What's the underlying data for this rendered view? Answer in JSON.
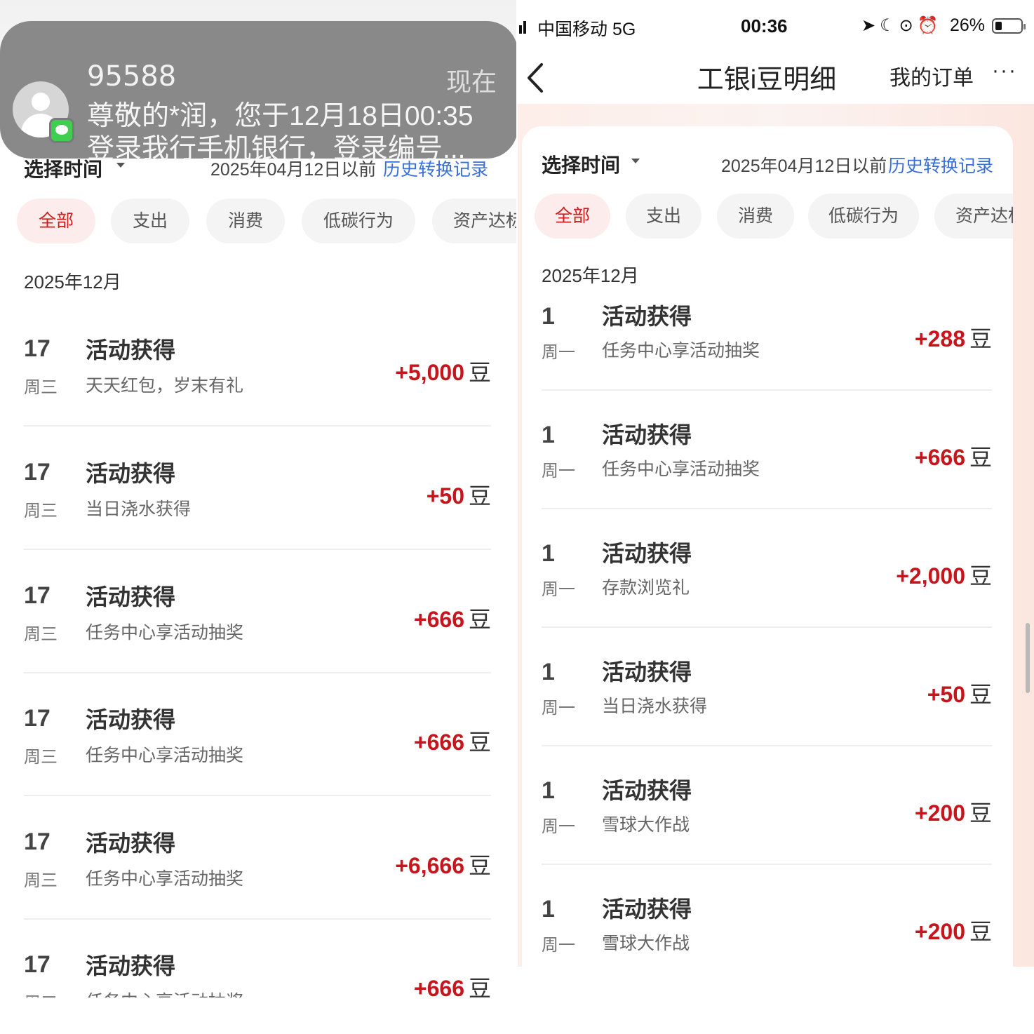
{
  "notification": {
    "sender": "95588",
    "time": "现在",
    "line1": "尊敬的*润，您于12月18日00:35",
    "line2": "登录我行手机银行，登录编号..."
  },
  "status_bar": {
    "carrier": "中国移动  5G",
    "time": "00:36",
    "battery": "26%",
    "battery_level": 0.26
  },
  "nav": {
    "title": "工银i豆明细",
    "orders": "我的订单",
    "more": "···"
  },
  "filter": {
    "select_time": "选择时间",
    "before_text": "2025年04月12日以前",
    "history_link": "历史转换记录"
  },
  "tabs": [
    "全部",
    "支出",
    "消费",
    "低碳行为",
    "资产达标"
  ],
  "unit": "豆",
  "left": {
    "month": "2025年12月",
    "items": [
      {
        "day": "17",
        "weekday": "周三",
        "title": "活动获得",
        "desc": "天天红包，岁末有礼",
        "amount": "+5,000"
      },
      {
        "day": "17",
        "weekday": "周三",
        "title": "活动获得",
        "desc": "当日浇水获得",
        "amount": "+50"
      },
      {
        "day": "17",
        "weekday": "周三",
        "title": "活动获得",
        "desc": "任务中心享活动抽奖",
        "amount": "+666"
      },
      {
        "day": "17",
        "weekday": "周三",
        "title": "活动获得",
        "desc": "任务中心享活动抽奖",
        "amount": "+666"
      },
      {
        "day": "17",
        "weekday": "周三",
        "title": "活动获得",
        "desc": "任务中心享活动抽奖",
        "amount": "+6,666"
      },
      {
        "day": "17",
        "weekday": "周三",
        "title": "活动获得",
        "desc": "任务中心享活动抽奖",
        "amount": "+666"
      }
    ]
  },
  "right": {
    "month": "2025年12月",
    "items": [
      {
        "day": "1",
        "weekday": "周一",
        "title": "活动获得",
        "desc": "任务中心享活动抽奖",
        "amount": "+288"
      },
      {
        "day": "1",
        "weekday": "周一",
        "title": "活动获得",
        "desc": "任务中心享活动抽奖",
        "amount": "+666"
      },
      {
        "day": "1",
        "weekday": "周一",
        "title": "活动获得",
        "desc": "存款浏览礼",
        "amount": "+2,000"
      },
      {
        "day": "1",
        "weekday": "周一",
        "title": "活动获得",
        "desc": "当日浇水获得",
        "amount": "+50"
      },
      {
        "day": "1",
        "weekday": "周一",
        "title": "活动获得",
        "desc": "雪球大作战",
        "amount": "+200"
      },
      {
        "day": "1",
        "weekday": "周一",
        "title": "活动获得",
        "desc": "雪球大作战",
        "amount": "+200"
      }
    ]
  }
}
